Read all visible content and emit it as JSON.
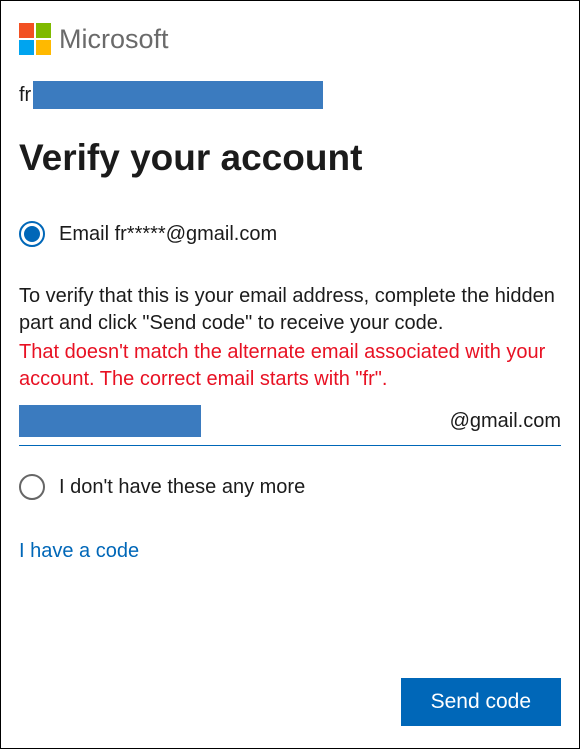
{
  "brand": {
    "name": "Microsoft",
    "colors": {
      "q1": "#f25022",
      "q2": "#7fba00",
      "q3": "#00a4ef",
      "q4": "#ffb900"
    }
  },
  "account": {
    "visible_prefix": "fr"
  },
  "title": "Verify your account",
  "radio_email": {
    "label": "Email fr*****@gmail.com",
    "selected": true
  },
  "instruction": "To verify that this is your email address, complete the hidden part and click \"Send code\" to receive your code.",
  "error_message": "That doesn't match the alternate email associated with your account. The correct email starts with \"fr\".",
  "email_input": {
    "entered_value_redacted": true,
    "domain_suffix": "@gmail.com"
  },
  "radio_nohave": {
    "label": "I don't have these any more",
    "selected": false
  },
  "link_have_code": "I have a code",
  "send_button": "Send code",
  "accent_color": "#0067b8",
  "error_color": "#e81123"
}
